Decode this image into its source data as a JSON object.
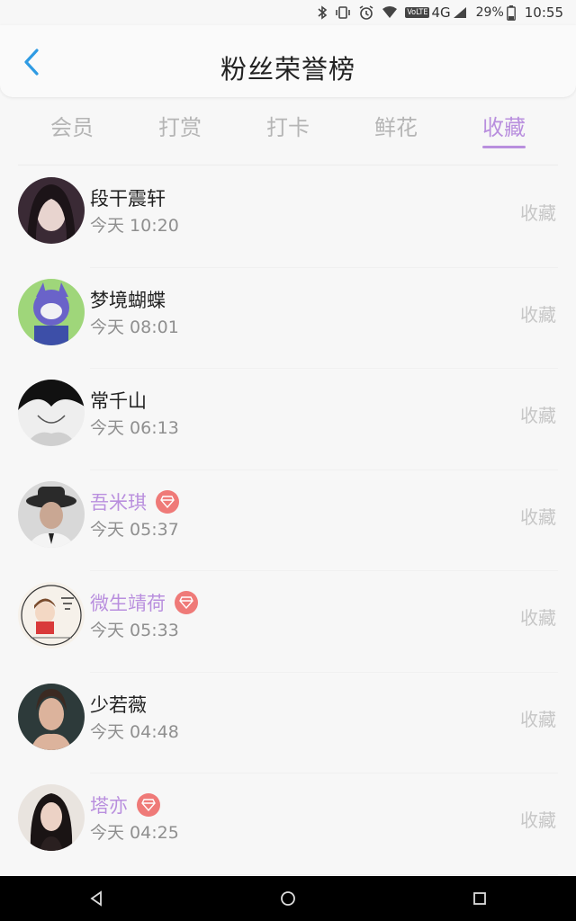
{
  "status_bar": {
    "volte": "VoLTE",
    "network": "4G",
    "battery": "29%",
    "time": "10:55"
  },
  "header": {
    "title": "粉丝荣誉榜"
  },
  "tabs": [
    {
      "label": "会员",
      "active": false
    },
    {
      "label": "打赏",
      "active": false
    },
    {
      "label": "打卡",
      "active": false
    },
    {
      "label": "鲜花",
      "active": false
    },
    {
      "label": "收藏",
      "active": true
    }
  ],
  "colors": {
    "accent": "#b98fde",
    "badge": "#ef7a78",
    "muted": "#8f8f8f"
  },
  "fans": [
    {
      "name": "段干震轩",
      "time": "今天 10:20",
      "action": "收藏",
      "vip": false
    },
    {
      "name": "梦境蝴蝶",
      "time": "今天 08:01",
      "action": "收藏",
      "vip": false
    },
    {
      "name": "常千山",
      "time": "今天 06:13",
      "action": "收藏",
      "vip": false
    },
    {
      "name": "吾米琪",
      "time": "今天 05:37",
      "action": "收藏",
      "vip": true
    },
    {
      "name": "微生靖荷",
      "time": "今天 05:33",
      "action": "收藏",
      "vip": true
    },
    {
      "name": "少若薇",
      "time": "今天 04:48",
      "action": "收藏",
      "vip": false
    },
    {
      "name": "塔亦",
      "time": "今天 04:25",
      "action": "收藏",
      "vip": true
    }
  ]
}
